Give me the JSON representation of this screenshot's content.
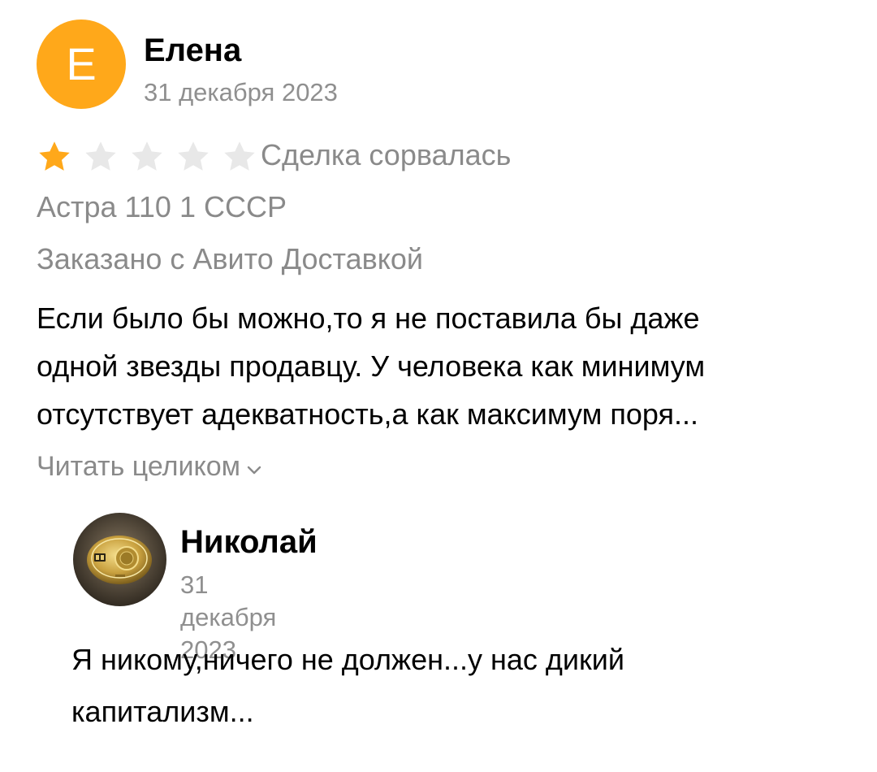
{
  "review": {
    "author": {
      "initial": "Е",
      "name": "Елена",
      "avatar_color": "#ffa81a"
    },
    "date": "31 декабря 2023",
    "rating": 1,
    "rating_max": 5,
    "star_color_filled": "#ffa81a",
    "star_color_empty": "#e8e8e8",
    "deal_status": "Сделка сорвалась",
    "product": "Астра 110 1 СССР",
    "delivery": "Заказано с Авито Доставкой",
    "text_lines": [
      "Если было бы можно,то я не поставила бы даже",
      "одной звезды продавцу. У человека как минимум",
      "отсутствует адекватность,а как максимум поря..."
    ],
    "read_more_label": "Читать целиком",
    "read_more_icon": "chevron-down-icon"
  },
  "reply": {
    "author": {
      "name": "Николай",
      "avatar": "coin-photo-avatar"
    },
    "date": "31 декабря 2023",
    "text_lines": [
      "Я никому,ничего не должен...у нас дикий",
      "капитализм..."
    ]
  }
}
